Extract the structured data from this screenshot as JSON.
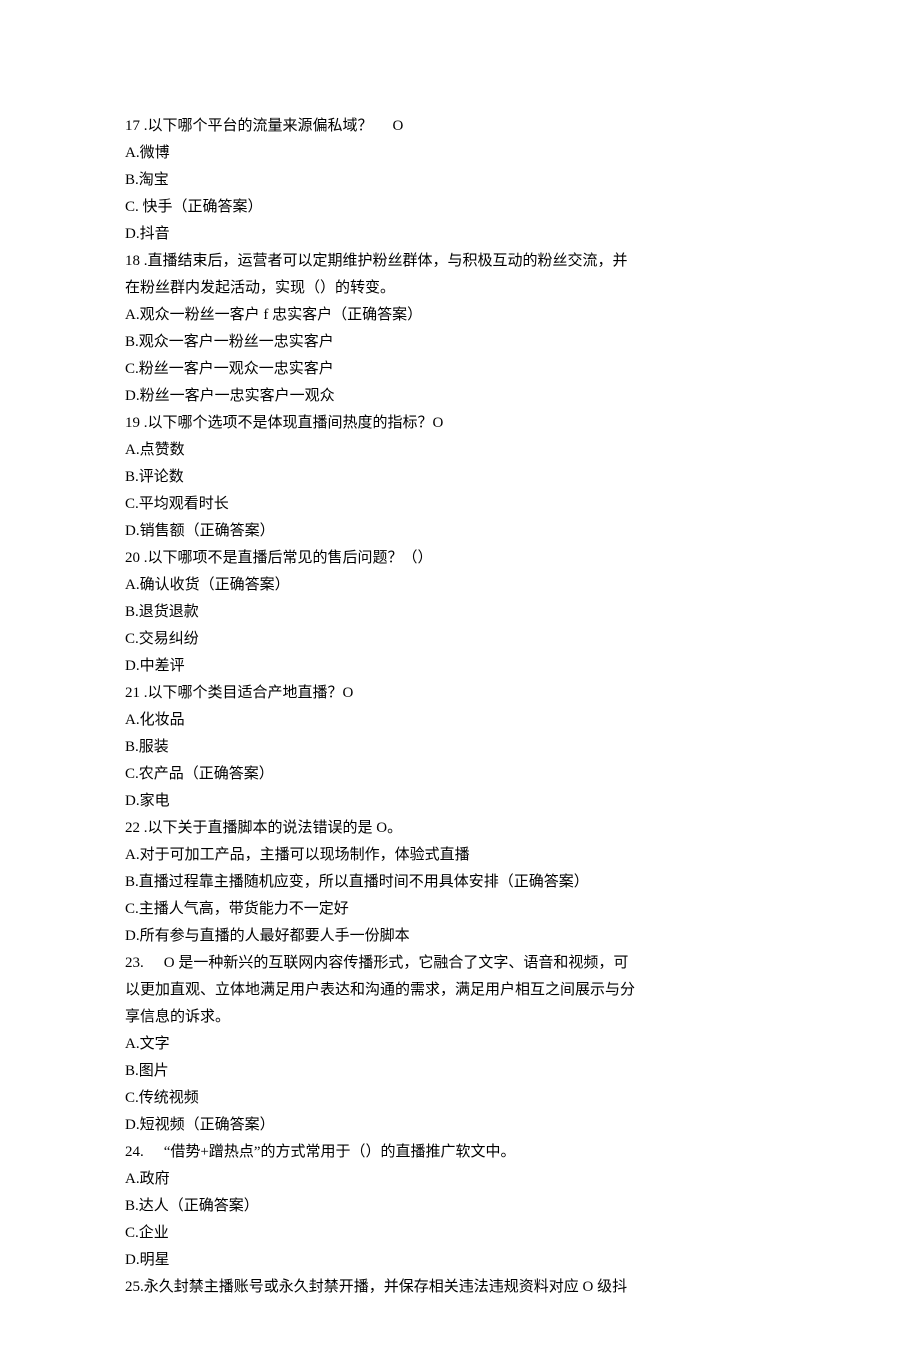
{
  "questions": [
    {
      "number": "17",
      "stem_parts": [
        " .以下哪个平台的流量来源偏私域？",
        "O"
      ],
      "options": [
        "A.微博",
        "B.淘宝",
        "C. 快手（正确答案）",
        "D.抖音"
      ]
    },
    {
      "number": "18",
      "stem_parts": [
        " .直播结束后，运营者可以定期维护粉丝群体，与积极互动的粉丝交流，并",
        "在粉丝群内发起活动，实现（）的转变。"
      ],
      "options": [
        "A.观众一粉丝一客户 f 忠实客户（正确答案）",
        "B.观众一客户一粉丝一忠实客户",
        "C.粉丝一客户一观众一忠实客户",
        "D.粉丝一客户一忠实客户一观众"
      ]
    },
    {
      "number": "19",
      "stem_parts": [
        " .以下哪个选项不是体现直播间热度的指标？O"
      ],
      "options": [
        "A.点赞数",
        "B.评论数",
        "C.平均观看时长",
        "D.销售额（正确答案）"
      ]
    },
    {
      "number": "20",
      "stem_parts": [
        " .以下哪项不是直播后常见的售后问题？（）"
      ],
      "options": [
        "A.确认收货（正确答案）",
        "B.退货退款",
        "C.交易纠纷",
        "D.中差评"
      ]
    },
    {
      "number": "21",
      "stem_parts": [
        " .以下哪个类目适合产地直播？O"
      ],
      "options": [
        "A.化妆品",
        "B.服装",
        "C.农产品（正确答案）",
        "D.家电"
      ]
    },
    {
      "number": "22",
      "stem_parts": [
        " .以下关于直播脚本的说法错误的是 O。"
      ],
      "options": [
        "A.对于可加工产品，主播可以现场制作，体验式直播",
        "B.直播过程靠主播随机应变，所以直播时间不用具体安排（正确答案）",
        "C.主播人气高，带货能力不一定好",
        "D.所有参与直播的人最好都要人手一份脚本"
      ]
    },
    {
      "number": "23.",
      "stem_parts": [
        "O 是一种新兴的互联网内容传播形式，它融合了文字、语音和视频，可",
        "以更加直观、立体地满足用户表达和沟通的需求，满足用户相互之间展示与分",
        "享信息的诉求。"
      ],
      "options": [
        "A.文字",
        "B.图片",
        "C.传统视频",
        "D.短视频（正确答案）"
      ]
    },
    {
      "number": "24.",
      "stem_parts": [
        "“借势+蹭热点”的方式常用于（）的直播推广软文中。"
      ],
      "options": [
        "A.政府",
        "B.达人（正确答案）",
        "C.企业",
        "D.明星"
      ]
    },
    {
      "number": "25.",
      "stem_parts": [
        "永久封禁主播账号或永久封禁开播，并保存相关违法违规资料对应 O 级抖"
      ],
      "options": []
    }
  ]
}
